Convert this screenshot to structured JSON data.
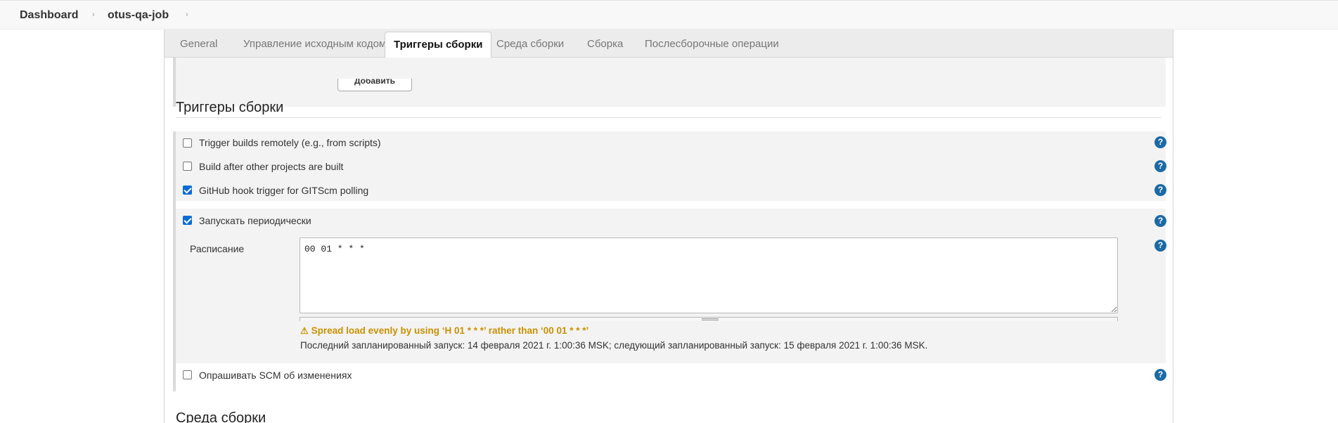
{
  "breadcrumb": {
    "items": [
      "Dashboard",
      "otus-qa-job"
    ],
    "separator": "›"
  },
  "tabs": [
    {
      "label": "General",
      "active": false
    },
    {
      "label": "Управление исходным кодом",
      "active": false
    },
    {
      "label": "Триггеры сборки",
      "active": true
    },
    {
      "label": "Среда сборки",
      "active": false
    },
    {
      "label": "Сборка",
      "active": false
    },
    {
      "label": "Послесборочные операции",
      "active": false
    }
  ],
  "prev_section": {
    "add_button_label": "Добавить"
  },
  "triggers": {
    "title": "Триггеры сборки",
    "options": [
      {
        "label": "Trigger builds remotely (e.g., from scripts)",
        "checked": false
      },
      {
        "label": "Build after other projects are built",
        "checked": false
      },
      {
        "label": "GitHub hook trigger for GITScm polling",
        "checked": true
      },
      {
        "label": "Запускать периодически",
        "checked": true
      },
      {
        "label": "Опрашивать SCM об изменениях",
        "checked": false
      }
    ],
    "schedule": {
      "label": "Расписание",
      "value": "00 01 * * *",
      "warning": "Spread load evenly by using ‘H 01 * * *’ rather than ‘00 01 * * *’",
      "info": "Последний запланированный запуск: 14 февраля 2021 г. 1:00:36 MSK; следующий запланированный запуск: 15 февраля 2021 г. 1:00:36 MSK."
    },
    "help_icon": "question-mark"
  },
  "next_section": {
    "title": "Среда сборки"
  },
  "colors": {
    "accent": "#0a6cd6",
    "help": "#1b6aa5",
    "warning": "#c89100"
  }
}
